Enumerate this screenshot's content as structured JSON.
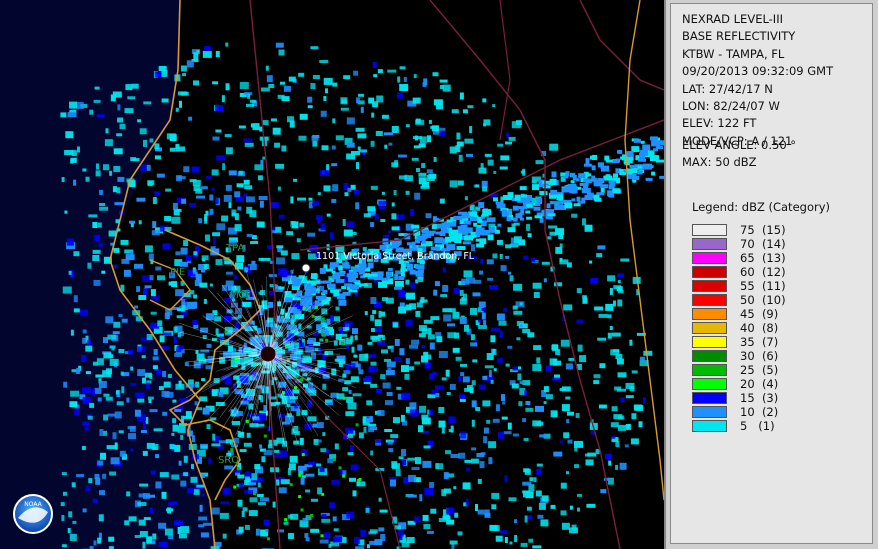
{
  "header": {
    "lines": [
      "NEXRAD LEVEL-III",
      "BASE REFLECTIVITY",
      "KTBW - TAMPA, FL",
      "09/20/2013 09:32:09 GMT",
      "LAT: 27/42/17 N",
      "LON: 82/24/07 W",
      "ELEV: 122 FT",
      "MODE/VCP: A / 121"
    ],
    "elev_angle": "ELEV ANGLE: 0.50 °",
    "max": "MAX: 50 dBZ"
  },
  "legend": {
    "title": "Legend: dBZ (Category)",
    "entries": [
      {
        "label": "75  (15)",
        "color": "#eeeeee"
      },
      {
        "label": "70  (14)",
        "color": "#9966cc"
      },
      {
        "label": "65  (13)",
        "color": "#ff00ff"
      },
      {
        "label": "60  (12)",
        "color": "#cc0000"
      },
      {
        "label": "55  (11)",
        "color": "#dd0000"
      },
      {
        "label": "50  (10)",
        "color": "#ff0000"
      },
      {
        "label": "45  (9)",
        "color": "#ff8c00"
      },
      {
        "label": "40  (8)",
        "color": "#e6b800"
      },
      {
        "label": "35  (7)",
        "color": "#ffff00"
      },
      {
        "label": "30  (6)",
        "color": "#008c00"
      },
      {
        "label": "25  (5)",
        "color": "#00bb00"
      },
      {
        "label": "20  (4)",
        "color": "#00ff00"
      },
      {
        "label": "15  (3)",
        "color": "#0000ff"
      },
      {
        "label": "10  (2)",
        "color": "#1e90ff"
      },
      {
        "label": "5   (1)",
        "color": "#00e5ee"
      }
    ]
  },
  "map": {
    "location_label": "1101 Victoria Street, Brandon, FL",
    "sites": [
      "TPA",
      "PIE",
      "MCF",
      "SRQ"
    ],
    "logo_text": "NOAA"
  }
}
